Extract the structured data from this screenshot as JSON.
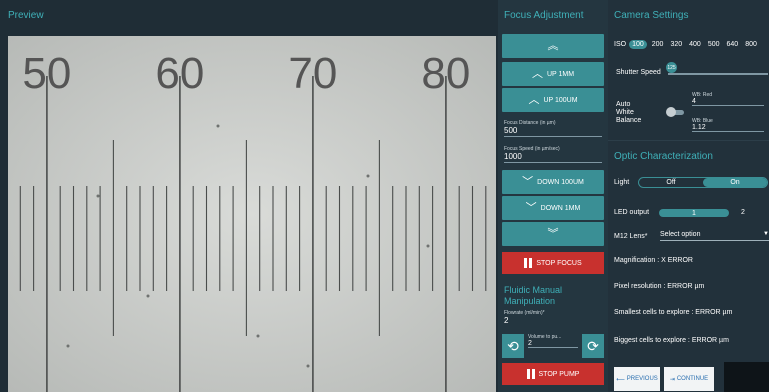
{
  "preview": {
    "title": "Preview",
    "ruler_numbers": [
      "50",
      "60",
      "70",
      "80"
    ]
  },
  "focus": {
    "title": "Focus Adjustment",
    "up_fast_icon": "double-chevron-up-icon",
    "up_1mm_label": "UP 1MM",
    "up_100um_label": "UP 100UM",
    "distance_label": "Focus Distance (in µm)",
    "distance_value": "500",
    "speed_label": "Focus Speed (in µm/sec)",
    "speed_value": "1000",
    "down_100um_label": "DOWN 100UM",
    "down_1mm_label": "DOWN 1MM",
    "down_fast_icon": "double-chevron-down-icon",
    "stop_label": "STOP FOCUS"
  },
  "fluidic": {
    "title": "Fluidic Manual Manipulation",
    "flowrate_label": "Flowrate (ml/min)*",
    "flowrate_value": "2",
    "volume_label": "Volume to pu...",
    "volume_value": "2",
    "stop_label": "STOP PUMP"
  },
  "camera": {
    "title": "Camera Settings",
    "iso_label": "ISO",
    "iso_options": [
      "100",
      "200",
      "320",
      "400",
      "500",
      "640",
      "800"
    ],
    "iso_selected": "100",
    "shutter_label": "Shutter Speed",
    "shutter_value": "125",
    "shutter_fraction": 0.03,
    "awb_label_1": "Auto",
    "awb_label_2": "White",
    "awb_label_3": "Balance",
    "wb_red_label": "WB: Red",
    "wb_red_value": "4",
    "wb_blue_label": "WB: Blue",
    "wb_blue_value": "1.12"
  },
  "optic": {
    "title": "Optic Characterization",
    "light_label": "Light",
    "light_off": "Off",
    "light_on": "On",
    "light_state": "On",
    "led_label": "LED output",
    "led_value_1": "1",
    "led_value_2": "2",
    "lens_label": "M12 Lens*",
    "lens_placeholder": "Select option",
    "magnification": "Magnification : X ERROR",
    "pixel_resolution": "Pixel resolution : ERROR µm",
    "smallest_cells": "Smallest cells to explore : ERROR µm",
    "biggest_cells": "Biggest cells to explore : ERROR µm",
    "previous_label": "PREVIOUS",
    "continue_label": "CONTINUE"
  },
  "colors": {
    "accent": "#3a8f95",
    "title": "#3fb0b8",
    "danger": "#c8312e",
    "panel": "#22313b"
  }
}
